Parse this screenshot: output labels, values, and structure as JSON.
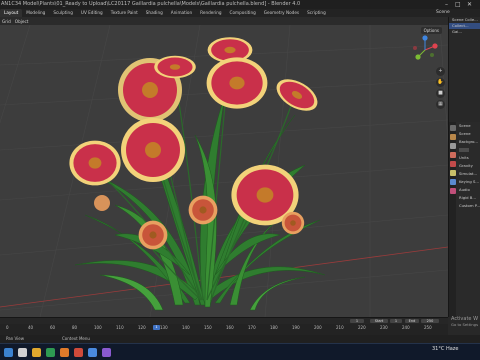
{
  "window": {
    "title": "AN1C34 Model\\Plants\\01_Ready to Upload\\LC20117 Gaillardia pulchella\\Models\\Gaillardia pulchella.blend] - Blender 4.0"
  },
  "workspaces": {
    "tabs": [
      "Layout",
      "Modeling",
      "Sculpting",
      "UV Editing",
      "Texture Paint",
      "Shading",
      "Animation",
      "Rendering",
      "Compositing",
      "Geometry Nodes",
      "Scripting"
    ],
    "active": "Layout"
  },
  "scene": {
    "label": "Scene"
  },
  "header": {
    "menus": [
      "Select",
      "Add",
      "Object"
    ],
    "left_items": [
      "Grid",
      "Object"
    ]
  },
  "viewport": {
    "options_label": "Options",
    "gizmo_axes": [
      "X",
      "Y",
      "Z"
    ],
    "nav_icons": [
      "magnify-icon",
      "hand-icon",
      "camera-icon",
      "grid-icon"
    ]
  },
  "outliner": {
    "rows": [
      "Scene Colle...",
      "Collect...",
      "Gai..."
    ]
  },
  "properties": {
    "rows": [
      "Scene",
      "Scene",
      "Backgro...",
      "Units",
      "Gravity",
      "Simulat...",
      "Keying S...",
      "Audio",
      "Rigid B...",
      "Custom P..."
    ]
  },
  "timeline": {
    "ticks": [
      "0",
      "40",
      "60",
      "80",
      "100",
      "110",
      "120",
      "130",
      "140",
      "150",
      "160",
      "170",
      "180",
      "190",
      "200",
      "210",
      "220",
      "230",
      "240",
      "250"
    ],
    "current_frame": "1",
    "start_label": "Start",
    "start_value": "1",
    "end_label": "End",
    "end_value": "250"
  },
  "statusbar": {
    "left": "Pan View",
    "mid": "Context Menu"
  },
  "watermark": {
    "line1": "Activate W",
    "line2": "Go to Settings"
  },
  "taskbar": {
    "weather": "31°C  Haze",
    "icons": [
      "start-icon",
      "search-icon",
      "files-icon",
      "browser-icon",
      "blender-icon",
      "chrome-icon",
      "explorer-icon",
      "media-icon"
    ]
  },
  "colors": {
    "accent": "#3f72c5",
    "viewport_bg": "#3d3d3d",
    "petal_red": "#c9304a",
    "petal_tip": "#f2d27a",
    "leaf_green": "#2f7d2f"
  }
}
